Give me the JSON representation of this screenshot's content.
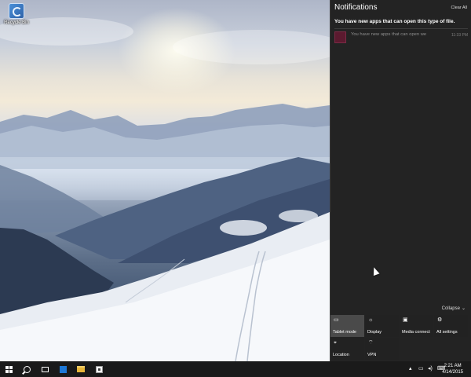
{
  "desktop": {
    "icons": [
      {
        "label": "Recycle Bin",
        "icon": "recycle-bin-icon"
      }
    ]
  },
  "action_center": {
    "title": "Notifications",
    "clear_all": "Clear All",
    "group_title": "You have new apps that can open this type of file.",
    "notification": {
      "text": "You have new apps that can open we",
      "time": "11:33 PM",
      "icon": "store-app-icon",
      "icon_color": "#5b1a2f"
    },
    "collapse_label": "Collapse",
    "quick_actions": [
      {
        "label": "Tablet mode",
        "icon": "tablet-icon",
        "active": true
      },
      {
        "label": "Display",
        "icon": "display-icon",
        "active": false
      },
      {
        "label": "Media connect",
        "icon": "media-connect-icon",
        "active": false
      },
      {
        "label": "All settings",
        "icon": "gear-icon",
        "active": false
      },
      {
        "label": "Location",
        "icon": "location-icon",
        "active": false
      },
      {
        "label": "VPN",
        "icon": "vpn-icon",
        "active": false
      }
    ]
  },
  "taskbar": {
    "clock_time": "2:21 AM",
    "clock_date": "4/14/2015",
    "tray_icons": [
      "chevron-up-icon",
      "network-icon",
      "volume-icon",
      "keyboard-icon"
    ]
  },
  "colors": {
    "action_center_bg": "#1c1c1c",
    "taskbar_bg": "#1a1a1a",
    "active_tile": "#4a4a4a"
  }
}
